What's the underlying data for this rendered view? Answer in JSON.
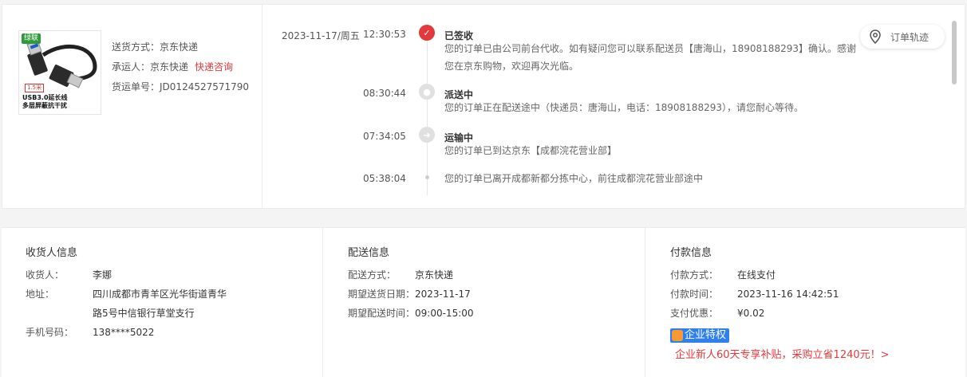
{
  "product": {
    "brand": "绿联",
    "length_badge": "1.5米",
    "caption_line1": "USB3.0延长线",
    "caption_line2": "多层屏蔽抗干扰",
    "delivery_method_label": "送货方式：",
    "delivery_method": "京东快递",
    "carrier_label": "承运人：",
    "carrier": "京东快递",
    "carrier_link": "快递咨询",
    "tracking_label": "货运单号：",
    "tracking_no": "JD0124527571790"
  },
  "timeline": {
    "events": [
      {
        "date": "2023-11-17/周五",
        "time": "12:30:53",
        "title": "已签收",
        "desc": "您的订单已由公司前台代收。如有疑问您可以联系配送员【唐海山，18908188293】确认。感谢您在京东购物，欢迎再次光临。"
      },
      {
        "date": "",
        "time": "08:30:44",
        "title": "派送中",
        "desc": "您的订单正在配送途中（快递员：唐海山，电话：18908188293），请您耐心等待。"
      },
      {
        "date": "",
        "time": "07:34:05",
        "title": "运输中",
        "desc": "您的订单已到达京东【成都浣花营业部】"
      },
      {
        "date": "",
        "time": "05:38:04",
        "title": "",
        "desc": "您的订单已离开成都新都分拣中心，前往成都浣花营业部途中"
      }
    ]
  },
  "track_button": {
    "label": "订单轨迹",
    "icon": "location-pin-icon"
  },
  "receiver": {
    "heading": "收货人信息",
    "name_label": "收货人：",
    "name": "李娜",
    "address_label": "地址：",
    "address_line1": "四川成都市青羊区光华街道青华",
    "address_line2": "路5号中信银行草堂支行",
    "phone_label": "手机号码：",
    "phone": "138****5022"
  },
  "shipping": {
    "heading": "配送信息",
    "method_label": "配送方式：",
    "method": "京东快递",
    "date_label": "期望送货日期：",
    "date": "2023-11-17",
    "time_label": "期望配送时间：",
    "time": "09:00-15:00"
  },
  "payment": {
    "heading": "付款信息",
    "method_label": "付款方式：",
    "method": "在线支付",
    "time_label": "付款时间：",
    "time": "2023-11-16 14:42:51",
    "discount_label": "支付优惠：",
    "discount": "¥0.02",
    "badge": "企业特权",
    "promo": "企业新人60天专享补贴，采购立省1240元！>"
  },
  "colors": {
    "accent": "#e4393c",
    "badge_blue": "#2f7ff0",
    "brand_green": "#2e9a3a"
  }
}
